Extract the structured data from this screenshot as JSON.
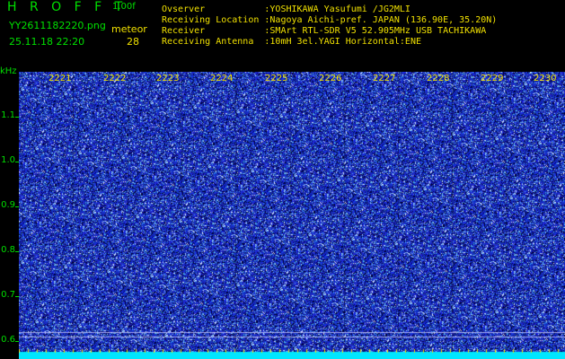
{
  "header": {
    "app_title": "H R O F F T",
    "app_version": "1.00f",
    "file_name": "YY2611182220.png",
    "timestamp": "25.11.18 22:20",
    "meteor_label": "meteor",
    "meteor_count": "28"
  },
  "info": {
    "observer": "Ovserver           :YOSHIKAWA Yasufumi /JG2MLI",
    "location": "Receiving Location :Nagoya Aichi-pref. JAPAN (136.90E, 35.20N)",
    "receiver": "Receiver           :SMArt RTL-SDR V5 52.905MHz USB TACHIKAWA",
    "antenna": "Receiving Antenna  :10mH 3el.YAGI Horizontal:ENE"
  },
  "axis": {
    "y_unit": "kHz",
    "y_ticks": [
      "1.1",
      "1.0",
      "0.9",
      "0.8",
      "0.7",
      "0.6"
    ],
    "x_ticks": [
      "2221",
      "2222",
      "2223",
      "2224",
      "2225",
      "2226",
      "2227",
      "2228",
      "2229",
      "2230"
    ]
  },
  "colors": {
    "title_green": "#00e000",
    "label_yellow": "#f0e000",
    "waterfall_blue": "#1a2ac8",
    "baseline_cyan": "#00e6ff"
  }
}
